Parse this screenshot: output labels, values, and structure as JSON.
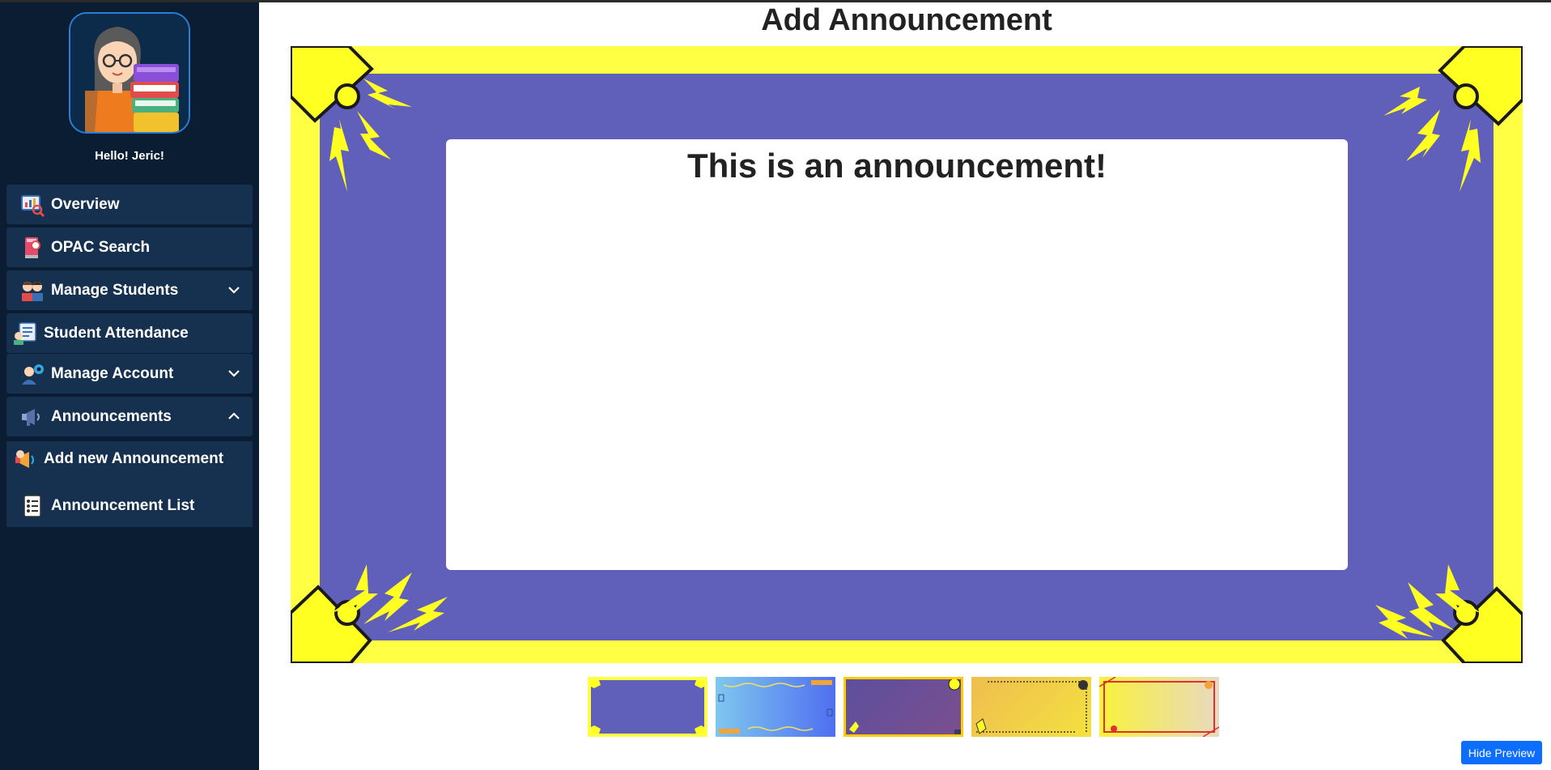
{
  "sidebar": {
    "greeting": "Hello! Jeric!",
    "items": [
      {
        "label": "Overview",
        "icon": "overview-icon"
      },
      {
        "label": "OPAC Search",
        "icon": "book-search-icon"
      },
      {
        "label": "Manage Students",
        "icon": "students-icon",
        "expandable": true,
        "expanded": false
      },
      {
        "label": "Student Attendance",
        "icon": "attendance-icon"
      },
      {
        "label": "Manage Account",
        "icon": "account-icon",
        "expandable": true,
        "expanded": false
      },
      {
        "label": "Announcements",
        "icon": "megaphone-icon",
        "expandable": true,
        "expanded": true
      }
    ],
    "subitems": [
      {
        "label": "Add new Announcement",
        "icon": "add-announcement-icon"
      },
      {
        "label": "Announcement List",
        "icon": "list-icon"
      }
    ]
  },
  "main": {
    "title": "Add Announcement",
    "preview_text": "This is an announcement!",
    "templates": [
      {
        "name": "template-purple-yellow",
        "bg": "#6060bb",
        "border": "#ffff44"
      },
      {
        "name": "template-blue-gradient",
        "bg": "#5a8ee0",
        "border": "#7fc7ef"
      },
      {
        "name": "template-purple-dark",
        "bg": "#6a4f95",
        "border": "#ffcc00"
      },
      {
        "name": "template-orange-yellow",
        "bg": "#f1c24f",
        "border": "#f0d44f"
      },
      {
        "name": "template-yellow-red",
        "bg": "#f2ec53",
        "border": "#e03030"
      }
    ],
    "hide_preview_label": "Hide Preview"
  },
  "colors": {
    "sidebar_bg": "#0b1d33",
    "nav_item_bg": "#15314f",
    "frame_yellow": "#ffff44",
    "frame_purple": "#6060bb",
    "button_blue": "#0d6efd"
  }
}
